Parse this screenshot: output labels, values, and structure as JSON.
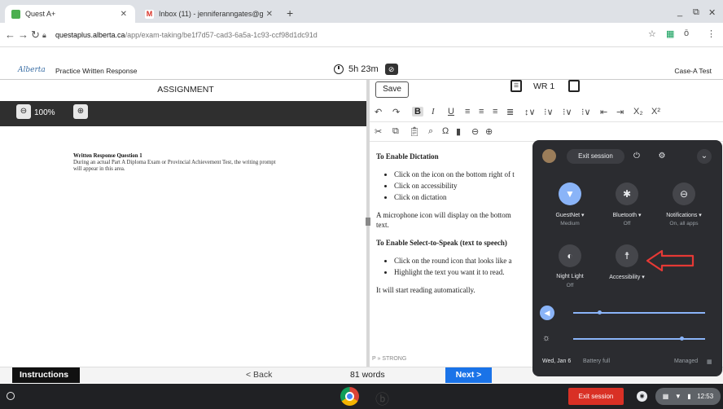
{
  "browser": {
    "tabs": [
      {
        "title": "Quest A+",
        "active": true
      },
      {
        "title": "Inbox (11) - jenniferanngates@g",
        "active": false
      }
    ],
    "new_tab": "+",
    "address": {
      "host": "questaplus.alberta.ca",
      "path": "/app/exam-taking/be1f7d57-cad3-6a5a-1c93-ccf98d1dc91d"
    },
    "window_controls": [
      "_",
      "⧉",
      "✕"
    ]
  },
  "app_header": {
    "logo": "Alberta",
    "title": "Practice Written Response",
    "timer": "5h 23m",
    "test_name": "Case-A Test"
  },
  "left_pane": {
    "tab_label": "ASSIGNMENT",
    "zoom": "100%",
    "question_title": "Written Response Question 1",
    "question_text": "During an actual Part A Diploma Exam or Provincial Achievement Test, the writing prompt will appear in this area."
  },
  "right_pane": {
    "save_label": "Save",
    "wr_label": "WR 1",
    "editor": {
      "heading1": "To Enable Dictation",
      "list1": [
        "Click on the icon on the bottom right of t",
        "Click on accessibility",
        "Click on dictation"
      ],
      "para1": "A microphone icon will display on the bottom",
      "para1b": "text.",
      "heading2": "To Enable Select-to-Speak (text to speech)",
      "list2": [
        "Click on the round icon that looks like a",
        "Highlight the text you want it to read."
      ],
      "para2": "It will start reading automatically."
    },
    "path_bar": "P » STRONG"
  },
  "bottom_bar": {
    "instructions": "Instructions",
    "back": "< Back",
    "word_count": "81 words",
    "next": "Next >"
  },
  "quick_settings": {
    "exit_session": "Exit session",
    "tiles": [
      {
        "label": "GuestNet",
        "sub": "Medium",
        "icon": "wifi-icon",
        "on": true
      },
      {
        "label": "Bluetooth",
        "sub": "Off",
        "icon": "bluetooth-icon",
        "on": false
      },
      {
        "label": "Notifications",
        "sub": "On, all apps",
        "icon": "notifications-icon",
        "on": false
      },
      {
        "label": "Night Light",
        "sub": "Off",
        "icon": "night-light-icon",
        "on": false
      },
      {
        "label": "Accessibility",
        "sub": "",
        "icon": "accessibility-icon",
        "on": false
      }
    ],
    "volume_level": 0.2,
    "brightness_level": 0.82,
    "date": "Wed, Jan 6",
    "battery": "Battery full",
    "managed": "Managed"
  },
  "shelf": {
    "exit_session": "Exit session",
    "time": "12:53"
  },
  "colors": {
    "accent": "#1a73e8",
    "qs_bg": "#2b2c30",
    "qs_accent": "#8ab4f8",
    "exit_red": "#d93025",
    "arrow_red": "#e53935"
  }
}
